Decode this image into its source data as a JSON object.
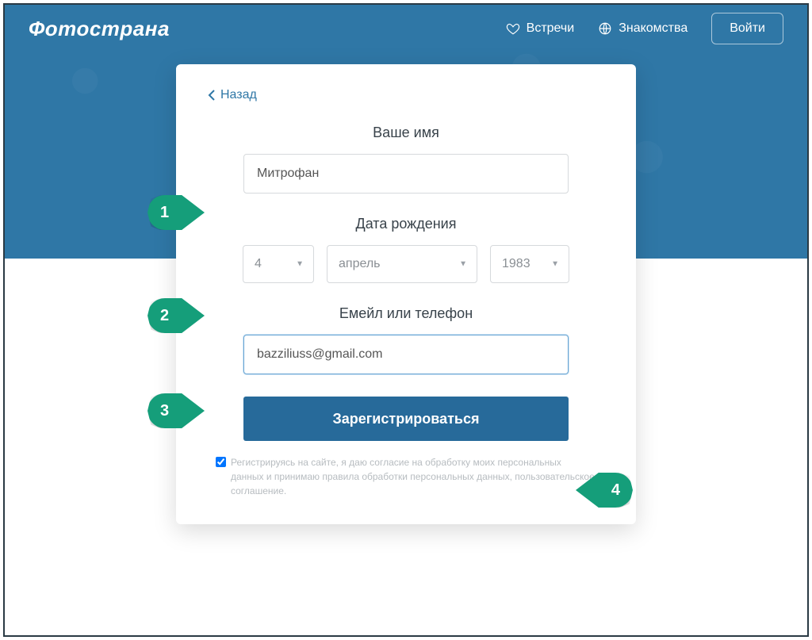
{
  "brand": {
    "name": "Фотострана"
  },
  "header": {
    "nav": {
      "meet": "Встречи",
      "dating": "Знакомства"
    },
    "login": "Войти"
  },
  "card": {
    "back": "Назад",
    "form": {
      "name_label": "Ваше имя",
      "name_value": "Митрофан",
      "dob_label": "Дата рождения",
      "day": "4",
      "month": "апрель",
      "year": "1983",
      "contact_label": "Емейл или телефон",
      "contact_value": "bazziliuss@gmail.com",
      "submit": "Зарегистрироваться",
      "consent": "Регистрируясь на сайте, я даю согласие на обработку моих персональных данных и принимаю правила обработки персональных данных, пользовательское соглашение."
    }
  },
  "markers": {
    "m1": "1",
    "m2": "2",
    "m3": "3",
    "m4": "4"
  },
  "colors": {
    "brand": "#2f77a6",
    "accent": "#159e7a",
    "button": "#276a9a"
  }
}
